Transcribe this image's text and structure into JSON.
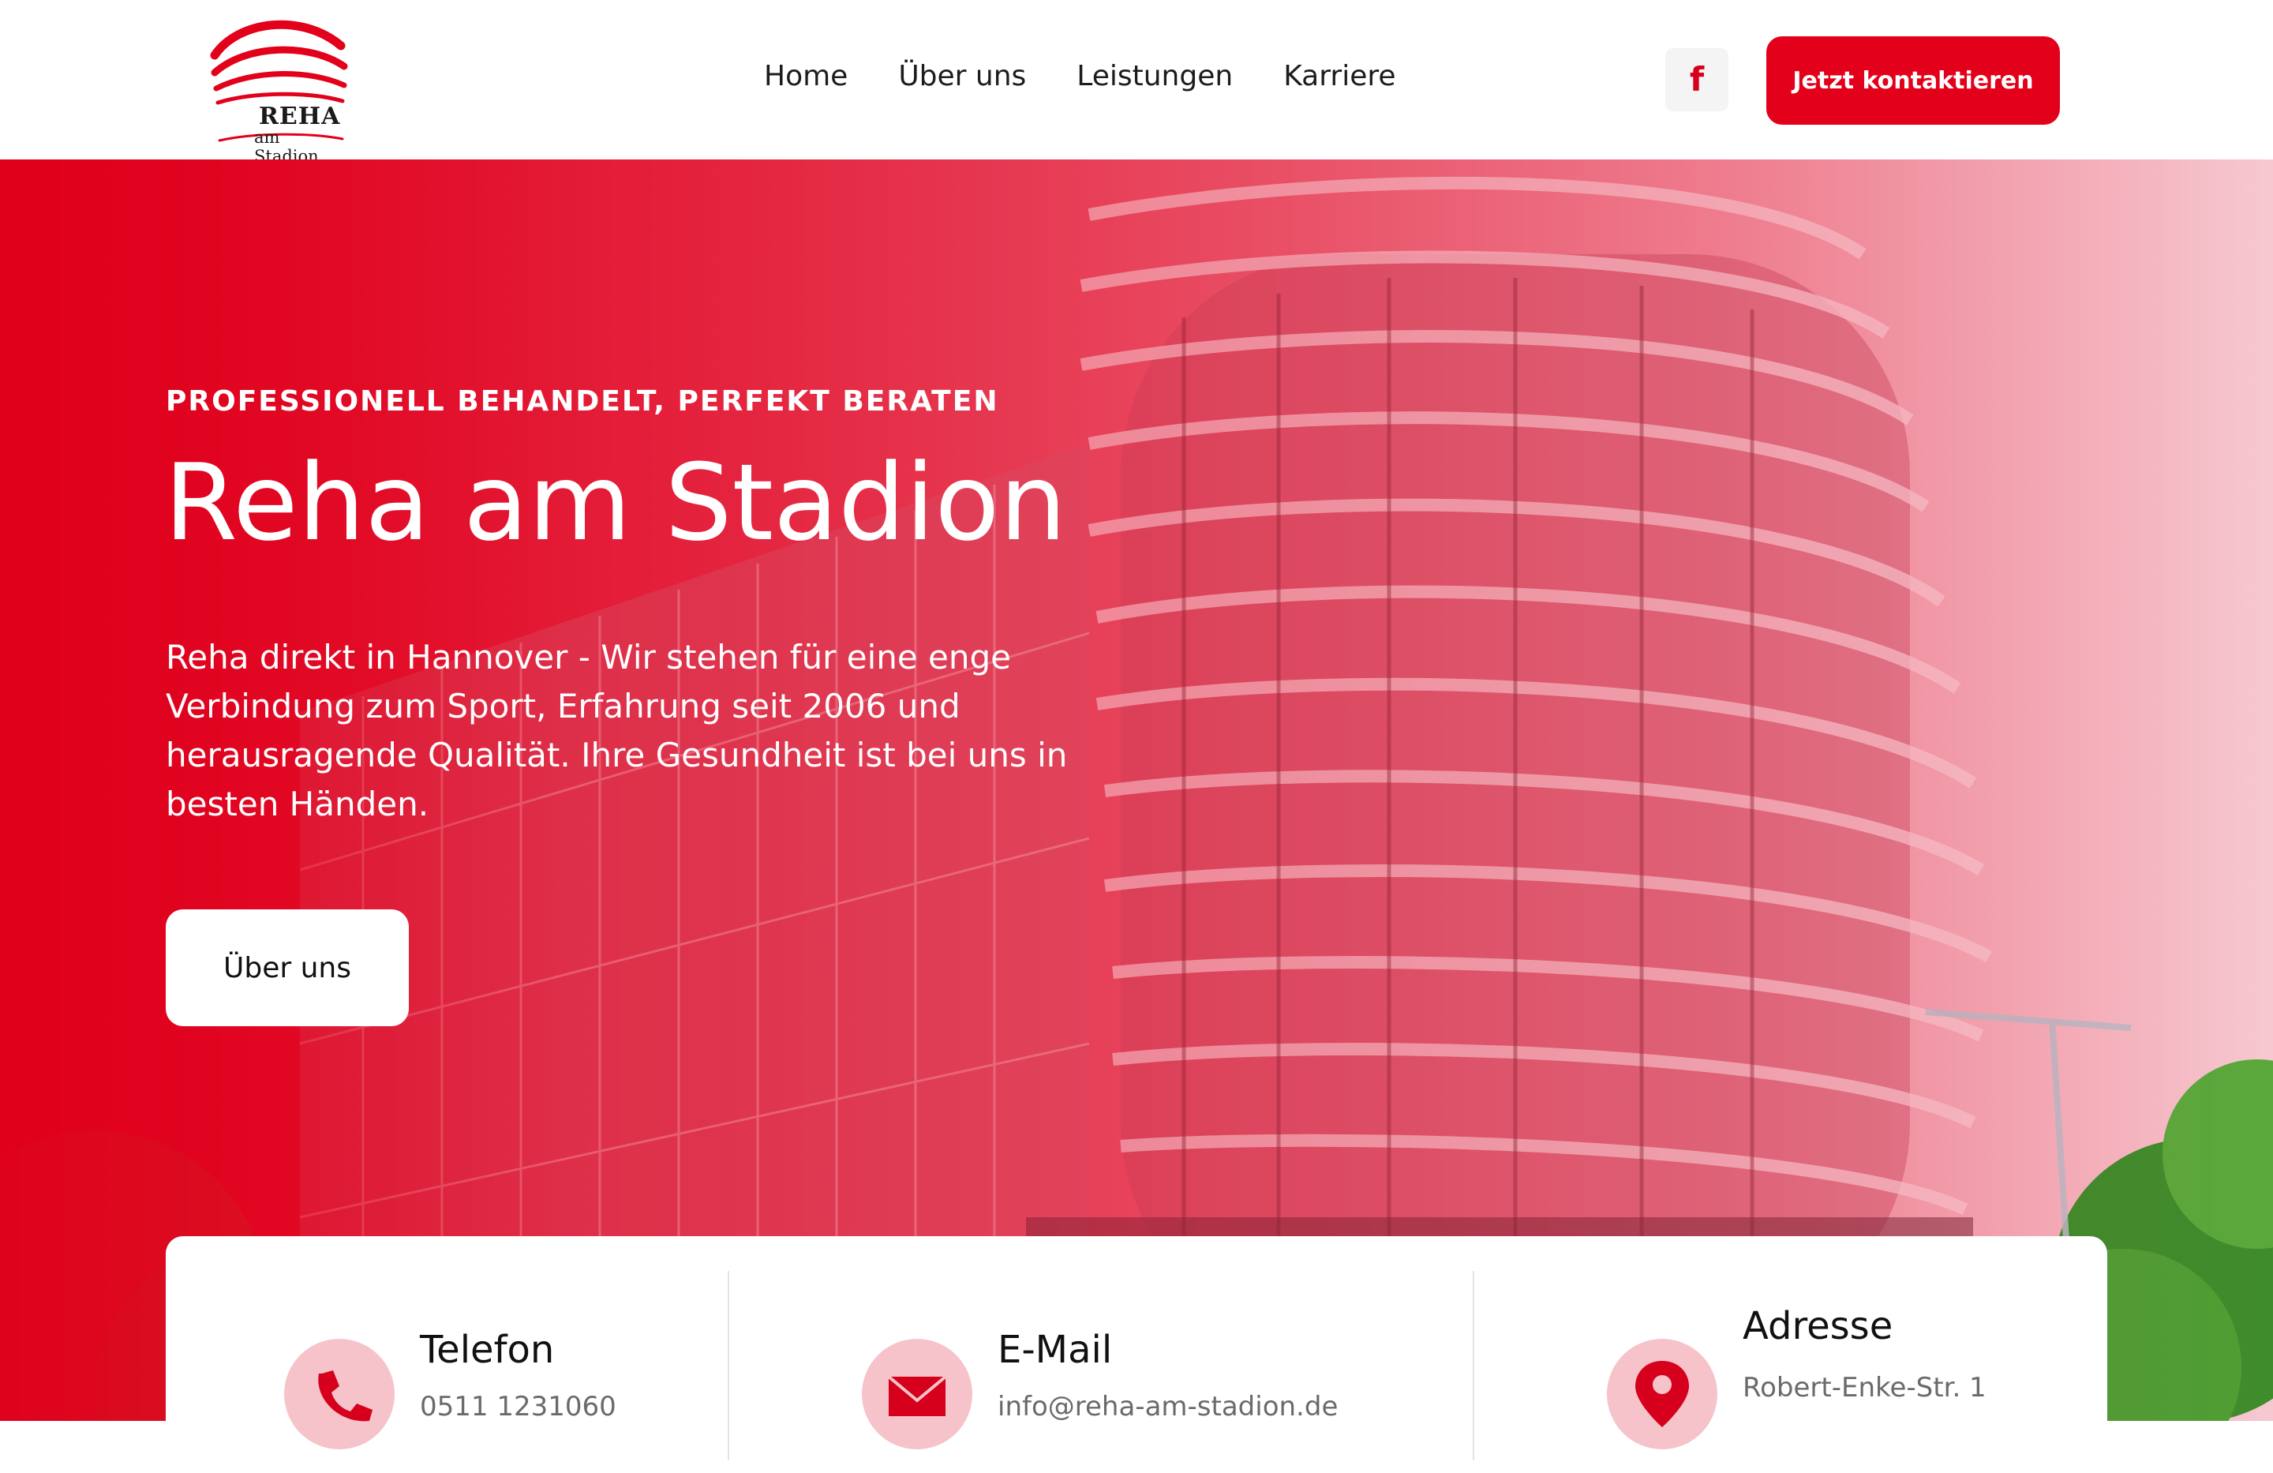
{
  "brand": {
    "logo_name": "REHA",
    "logo_sub": "am Stadion"
  },
  "nav": {
    "items": [
      {
        "label": "Home"
      },
      {
        "label": "Über uns"
      },
      {
        "label": "Leistungen"
      },
      {
        "label": "Karriere"
      }
    ]
  },
  "header": {
    "facebook_icon": "f",
    "cta_label": "Jetzt kontaktieren"
  },
  "hero": {
    "tagline": "PROFESSIONELL BEHANDELT, PERFEKT BERATEN",
    "title": "Reha am Stadion",
    "text": "Reha direkt in Hannover - Wir stehen für eine enge Verbindung zum Sport, Erfahrung seit 2006 und herausragende Qualität. Ihre Gesundheit ist bei uns in besten Händen.",
    "button_label": "Über uns"
  },
  "contact": {
    "items": [
      {
        "title": "Telefon",
        "value": "0511 1231060",
        "icon": "phone-icon"
      },
      {
        "title": "E-Mail",
        "value": "info@reha-am-stadion.de",
        "icon": "mail-icon"
      },
      {
        "title": "Adresse",
        "value": "Robert-Enke-Str. 1",
        "icon": "map-pin-icon"
      }
    ]
  },
  "colors": {
    "brand_red": "#e2001a",
    "icon_circle": "#f5c3c9",
    "text_dark": "#111111",
    "text_muted": "#6a6a6a"
  }
}
